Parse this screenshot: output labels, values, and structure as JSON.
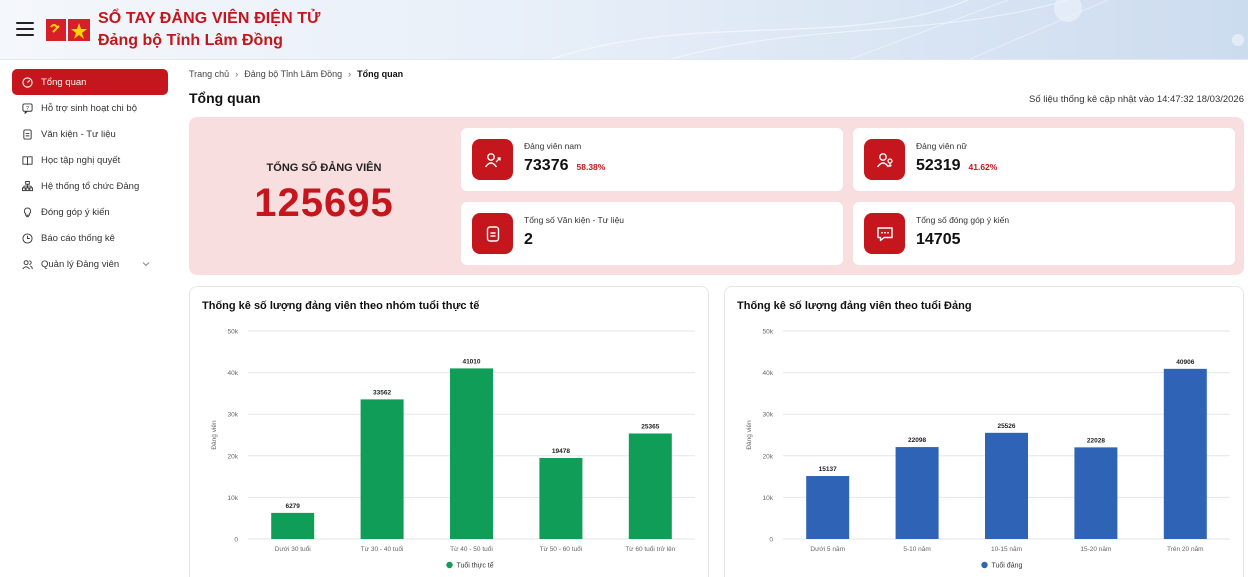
{
  "header": {
    "title": "SỔ TAY ĐẢNG VIÊN ĐIỆN TỬ",
    "subtitle": "Đảng bộ Tỉnh Lâm Đồng",
    "brand_color": "#c4161c"
  },
  "sidebar": {
    "items": [
      {
        "label": "Tổng quan",
        "icon": "dashboard-icon",
        "active": true
      },
      {
        "label": "Hỗ trợ sinh hoạt chi bộ",
        "icon": "chat-help-icon"
      },
      {
        "label": "Văn kiện - Tư liệu",
        "icon": "document-icon"
      },
      {
        "label": "Học tập nghị quyết",
        "icon": "book-icon"
      },
      {
        "label": "Hệ thống tổ chức Đảng",
        "icon": "org-chart-icon"
      },
      {
        "label": "Đóng góp ý kiến",
        "icon": "lightbulb-icon"
      },
      {
        "label": "Báo cáo thống kê",
        "icon": "clock-report-icon"
      },
      {
        "label": "Quản lý Đảng viên",
        "icon": "users-icon",
        "expandable": true
      }
    ]
  },
  "breadcrumb": {
    "home": "Trang chủ",
    "parent": "Đảng bộ Tỉnh Lâm Đồng",
    "current": "Tổng quan"
  },
  "page": {
    "title": "Tổng quan",
    "updated": "Số liệu thống kê cập nhật vào 14:47:32 18/03/2026"
  },
  "stats": {
    "total_label": "TỔNG SỐ ĐẢNG VIÊN",
    "total_value": "125695",
    "male": {
      "label": "Đảng viên nam",
      "value": "73376",
      "pct": "58.38%"
    },
    "female": {
      "label": "Đảng viên nữ",
      "value": "52319",
      "pct": "41.62%"
    },
    "documents": {
      "label": "Tổng số Văn kiện - Tư liệu",
      "value": "2"
    },
    "feedback": {
      "label": "Tổng số đóng góp ý kiến",
      "value": "14705"
    }
  },
  "chart_data": [
    {
      "type": "bar",
      "title": "Thống kê số lượng đảng viên theo nhóm tuổi thực tế",
      "ylabel": "Đảng viên",
      "ylim": [
        0,
        50000
      ],
      "yticks": [
        "0",
        "10k",
        "20k",
        "30k",
        "40k",
        "50k"
      ],
      "categories": [
        "Dưới 30 tuổi",
        "Từ 30 - 40 tuổi",
        "Từ 40 - 50 tuổi",
        "Từ 50 - 60 tuổi",
        "Từ 60 tuổi trở lên"
      ],
      "series": [
        {
          "name": "Tuổi thực tế",
          "values": [
            6279,
            33562,
            41010,
            19478,
            25365
          ],
          "color": "#0f9d58"
        }
      ],
      "legend": "bottom",
      "grid": true
    },
    {
      "type": "bar",
      "title": "Thống kê số lượng đảng viên theo tuổi Đảng",
      "ylabel": "Đảng viên",
      "ylim": [
        0,
        50000
      ],
      "yticks": [
        "0",
        "10k",
        "20k",
        "30k",
        "40k",
        "50k"
      ],
      "categories": [
        "Dưới 5 năm",
        "5-10 năm",
        "10-15 năm",
        "15-20 năm",
        "Trên 20 năm"
      ],
      "series": [
        {
          "name": "Tuổi đảng",
          "values": [
            15137,
            22098,
            25526,
            22028,
            40906
          ],
          "color": "#2f63b5"
        }
      ],
      "legend": "bottom",
      "grid": true
    }
  ]
}
